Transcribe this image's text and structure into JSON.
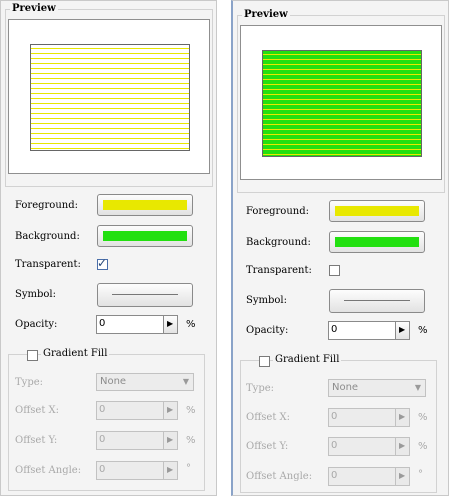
{
  "preview": {
    "title": "Preview"
  },
  "labels": {
    "foreground": "Foreground:",
    "background": "Background:",
    "transparent": "Transparent:",
    "symbol": "Symbol:",
    "opacity": "Opacity:",
    "gradient_fill": "Gradient Fill",
    "type": "Type:",
    "offset_x": "Offset X:",
    "offset_y": "Offset Y:",
    "offset_angle": "Offset Angle:"
  },
  "units": {
    "percent": "%",
    "degree": "°"
  },
  "icons": {
    "spin_arrow": "▶",
    "dropdown_arrow": "▼",
    "check": "✓"
  },
  "panels": [
    {
      "foreground_color": "#e8e800",
      "background_color": "#22e010",
      "transparent_checked": true,
      "opacity": "0",
      "type": "None",
      "offset_x": "0",
      "offset_y": "0",
      "offset_angle": "0"
    },
    {
      "foreground_color": "#e8e800",
      "background_color": "#22e010",
      "transparent_checked": false,
      "opacity": "0",
      "type": "None",
      "offset_x": "0",
      "offset_y": "0",
      "offset_angle": "0"
    }
  ]
}
